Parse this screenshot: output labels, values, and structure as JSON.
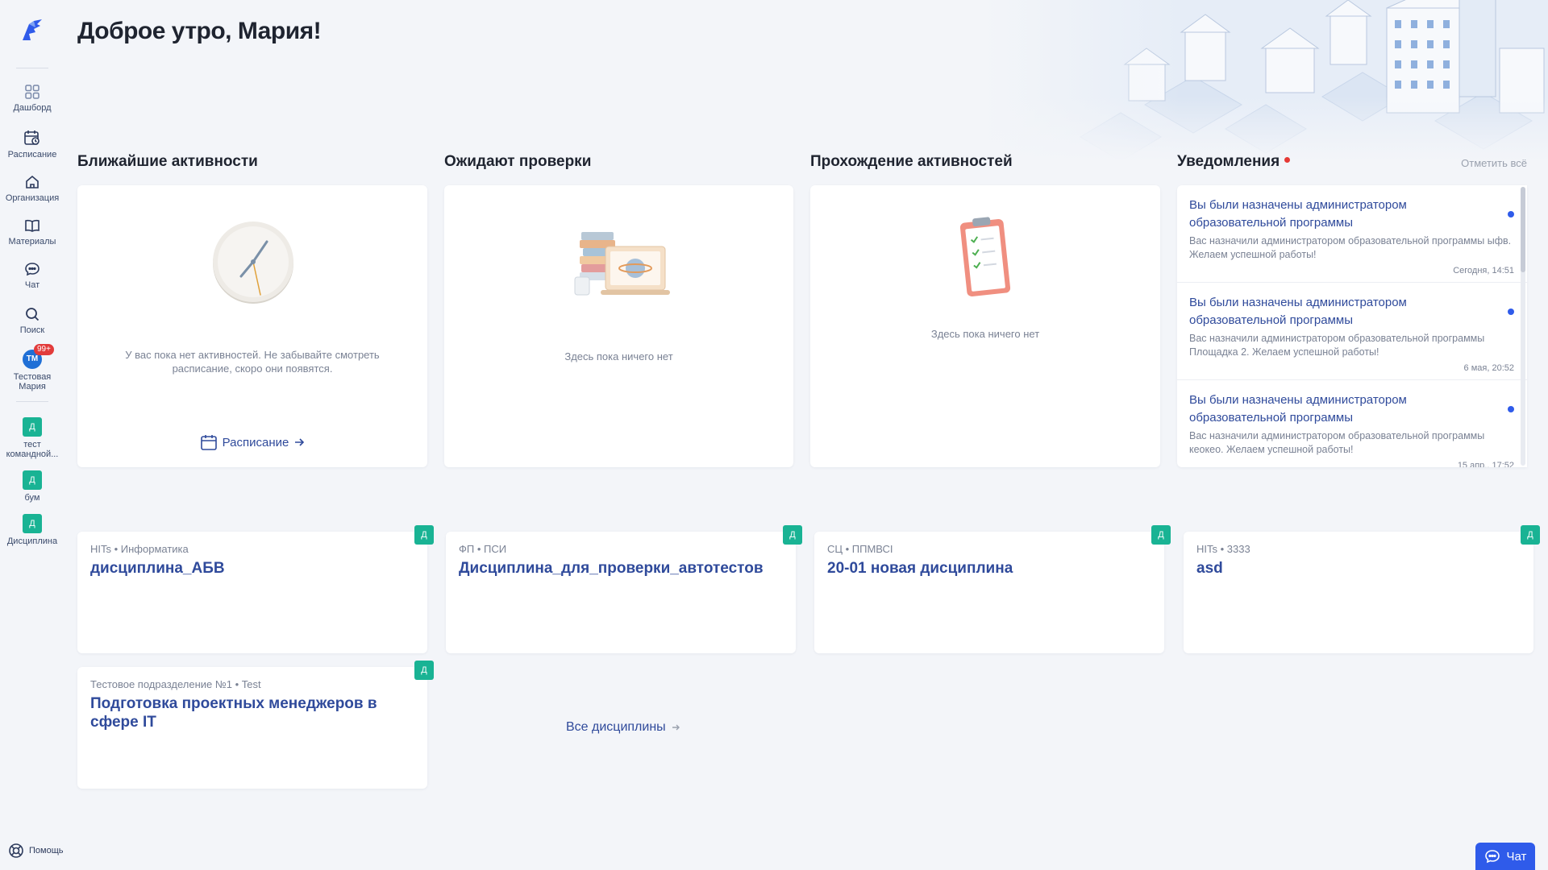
{
  "sidebar": {
    "items": [
      {
        "label": "Дашборд",
        "icon": "grid-icon"
      },
      {
        "label": "Расписание",
        "icon": "calendar-clock-icon"
      },
      {
        "label": "Организация",
        "icon": "home-icon"
      },
      {
        "label": "Материалы",
        "icon": "book-icon"
      },
      {
        "label": "Чат",
        "icon": "chat-icon"
      },
      {
        "label": "Поиск",
        "icon": "search-icon"
      }
    ],
    "user": {
      "initials": "ТМ",
      "badge": "99+",
      "name_line1": "Тестовая",
      "name_line2": "Мария"
    },
    "teams": [
      {
        "tag": "Д",
        "label_line1": "тест",
        "label_line2": "командной..."
      },
      {
        "tag": "Д",
        "label_line1": "бум",
        "label_line2": ""
      },
      {
        "tag": "Д",
        "label_line1": "Дисциплина",
        "label_line2": ""
      }
    ],
    "help_label": "Помощь"
  },
  "greeting": "Доброе утро, Мария!",
  "sections": {
    "upcoming": {
      "title": "Ближайшие активности",
      "empty_text": "У вас пока нет активностей. Не забывайте смотреть расписание, скоро они появятся.",
      "link": "Расписание"
    },
    "review": {
      "title": "Ожидают проверки",
      "empty_text": "Здесь пока ничего нет"
    },
    "progress": {
      "title": "Прохождение активностей",
      "empty_text": "Здесь пока ничего нет"
    },
    "notifications": {
      "title": "Уведомления",
      "mark_all": "Отметить всё",
      "items": [
        {
          "title": "Вы были назначены администратором образовательной программы",
          "body": "Вас назначили администратором образовательной программы ыфв. Желаем успешной работы!",
          "date": "Сегодня, 14:51"
        },
        {
          "title": "Вы были назначены администратором образовательной программы",
          "body": "Вас назначили администратором образовательной программы Площадка 2. Желаем успешной работы!",
          "date": "6 мая, 20:52"
        },
        {
          "title": "Вы были назначены администратором образовательной программы",
          "body": "Вас назначили администратором образовательной программы кеокео. Желаем успешной работы!",
          "date": "15 апр., 17:52"
        }
      ]
    }
  },
  "disciplines": [
    {
      "meta": "HITs • Информатика",
      "name": "дисциплина_АБВ",
      "tag": "Д"
    },
    {
      "meta": "ФП • ПСИ",
      "name": "Дисциплина_для_проверки_автотестов",
      "tag": "Д"
    },
    {
      "meta": "СЦ • ППМВСI",
      "name": "20-01 новая дисциплина",
      "tag": "Д"
    },
    {
      "meta": "HITs • 3333",
      "name": "asd",
      "tag": "Д"
    },
    {
      "meta": "Тестовое подразделение №1 • Test",
      "name": "Подготовка проектных менеджеров в сфере IT",
      "tag": "Д"
    }
  ],
  "all_disciplines": "Все дисциплины",
  "chat_button": "Чат",
  "colors": {
    "accent": "#2f4a9b",
    "primary": "#2f5bea",
    "tag_green": "#19b394",
    "badge_red": "#e23b3b"
  }
}
